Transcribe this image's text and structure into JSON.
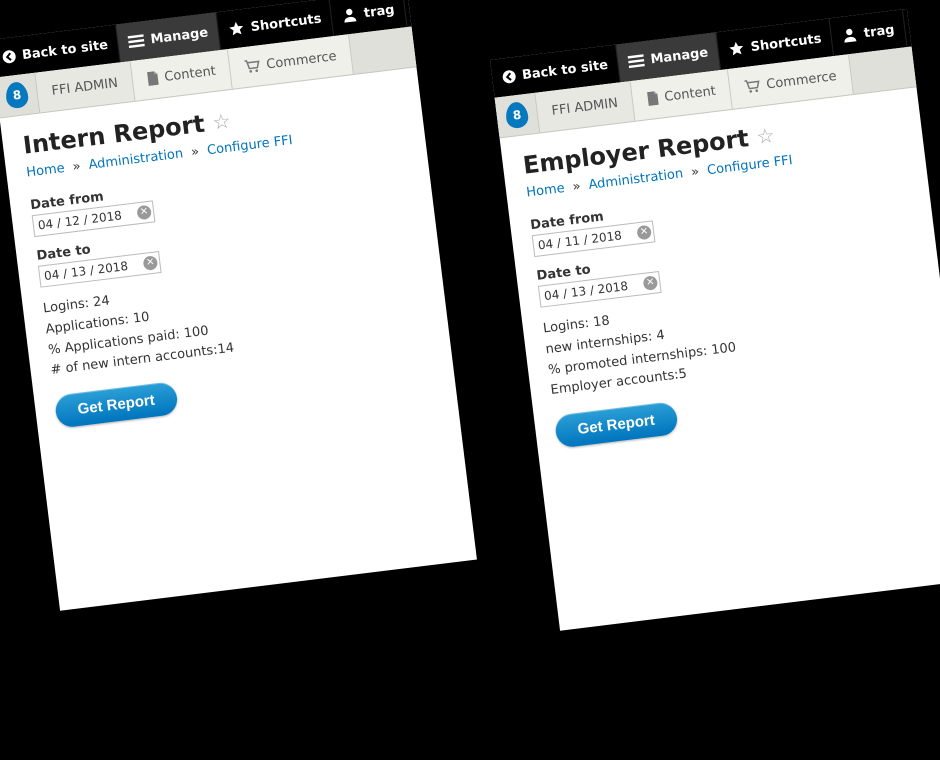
{
  "topbar": {
    "back": "Back to site",
    "manage": "Manage",
    "shortcuts": "Shortcuts",
    "user": "trag"
  },
  "secondbar": {
    "admin": "FFI ADMIN",
    "content": "Content",
    "commerce": "Commerce"
  },
  "breadcrumb": {
    "home": "Home",
    "admin": "Administration",
    "configure": "Configure FFI"
  },
  "left": {
    "title": "Intern Report",
    "date_from_label": "Date from",
    "date_from_value": "04 / 12 / 2018",
    "date_to_label": "Date to",
    "date_to_value": "04 / 13 / 2018",
    "stats": {
      "logins_label": "Logins:",
      "logins_value": "24",
      "applications_label": "Applications:",
      "applications_value": "10",
      "pct_paid_label": "% Applications paid:",
      "pct_paid_value": "100",
      "new_accounts_label": "# of new intern accounts:",
      "new_accounts_value": "14"
    },
    "button": "Get Report"
  },
  "right": {
    "title": "Employer Report",
    "date_from_label": "Date from",
    "date_from_value": "04 / 11 / 2018",
    "date_to_label": "Date to",
    "date_to_value": "04 / 13 / 2018",
    "stats": {
      "logins_label": "Logins:",
      "logins_value": "18",
      "new_internships_label": "new internships:",
      "new_internships_value": "4",
      "pct_promoted_label": "% promoted internships:",
      "pct_promoted_value": "100",
      "employer_accounts_label": "Employer accounts:",
      "employer_accounts_value": "5"
    },
    "button": "Get Report"
  }
}
